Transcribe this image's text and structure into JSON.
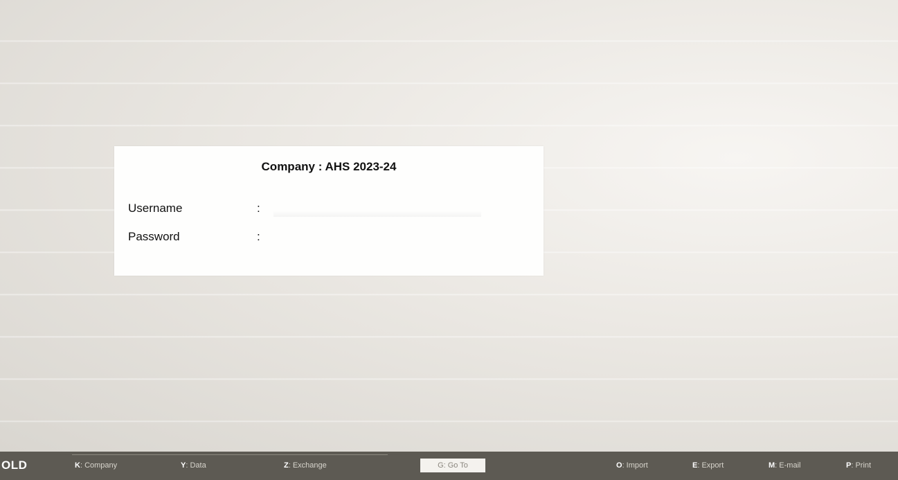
{
  "login": {
    "title": "Company : AHS 2023-24",
    "username_label": "Username",
    "password_label": "Password",
    "separator": ":",
    "username_value": "",
    "password_value": ""
  },
  "bottom_bar": {
    "brand": "OLD",
    "items": [
      {
        "key": "K",
        "label": ": Company"
      },
      {
        "key": "Y",
        "label": ": Data"
      },
      {
        "key": "Z",
        "label": ": Exchange"
      },
      {
        "key": "O",
        "label": ": Import"
      },
      {
        "key": "E",
        "label": ": Export"
      },
      {
        "key": "M",
        "label": ": E-mail"
      },
      {
        "key": "P",
        "label": ": Print"
      }
    ],
    "goto": {
      "key": "G",
      "label": ": Go To"
    }
  },
  "colors": {
    "bar_background": "#5d5a53",
    "panel_background": "#fefefd",
    "workspace_background": "#e6e3de"
  }
}
